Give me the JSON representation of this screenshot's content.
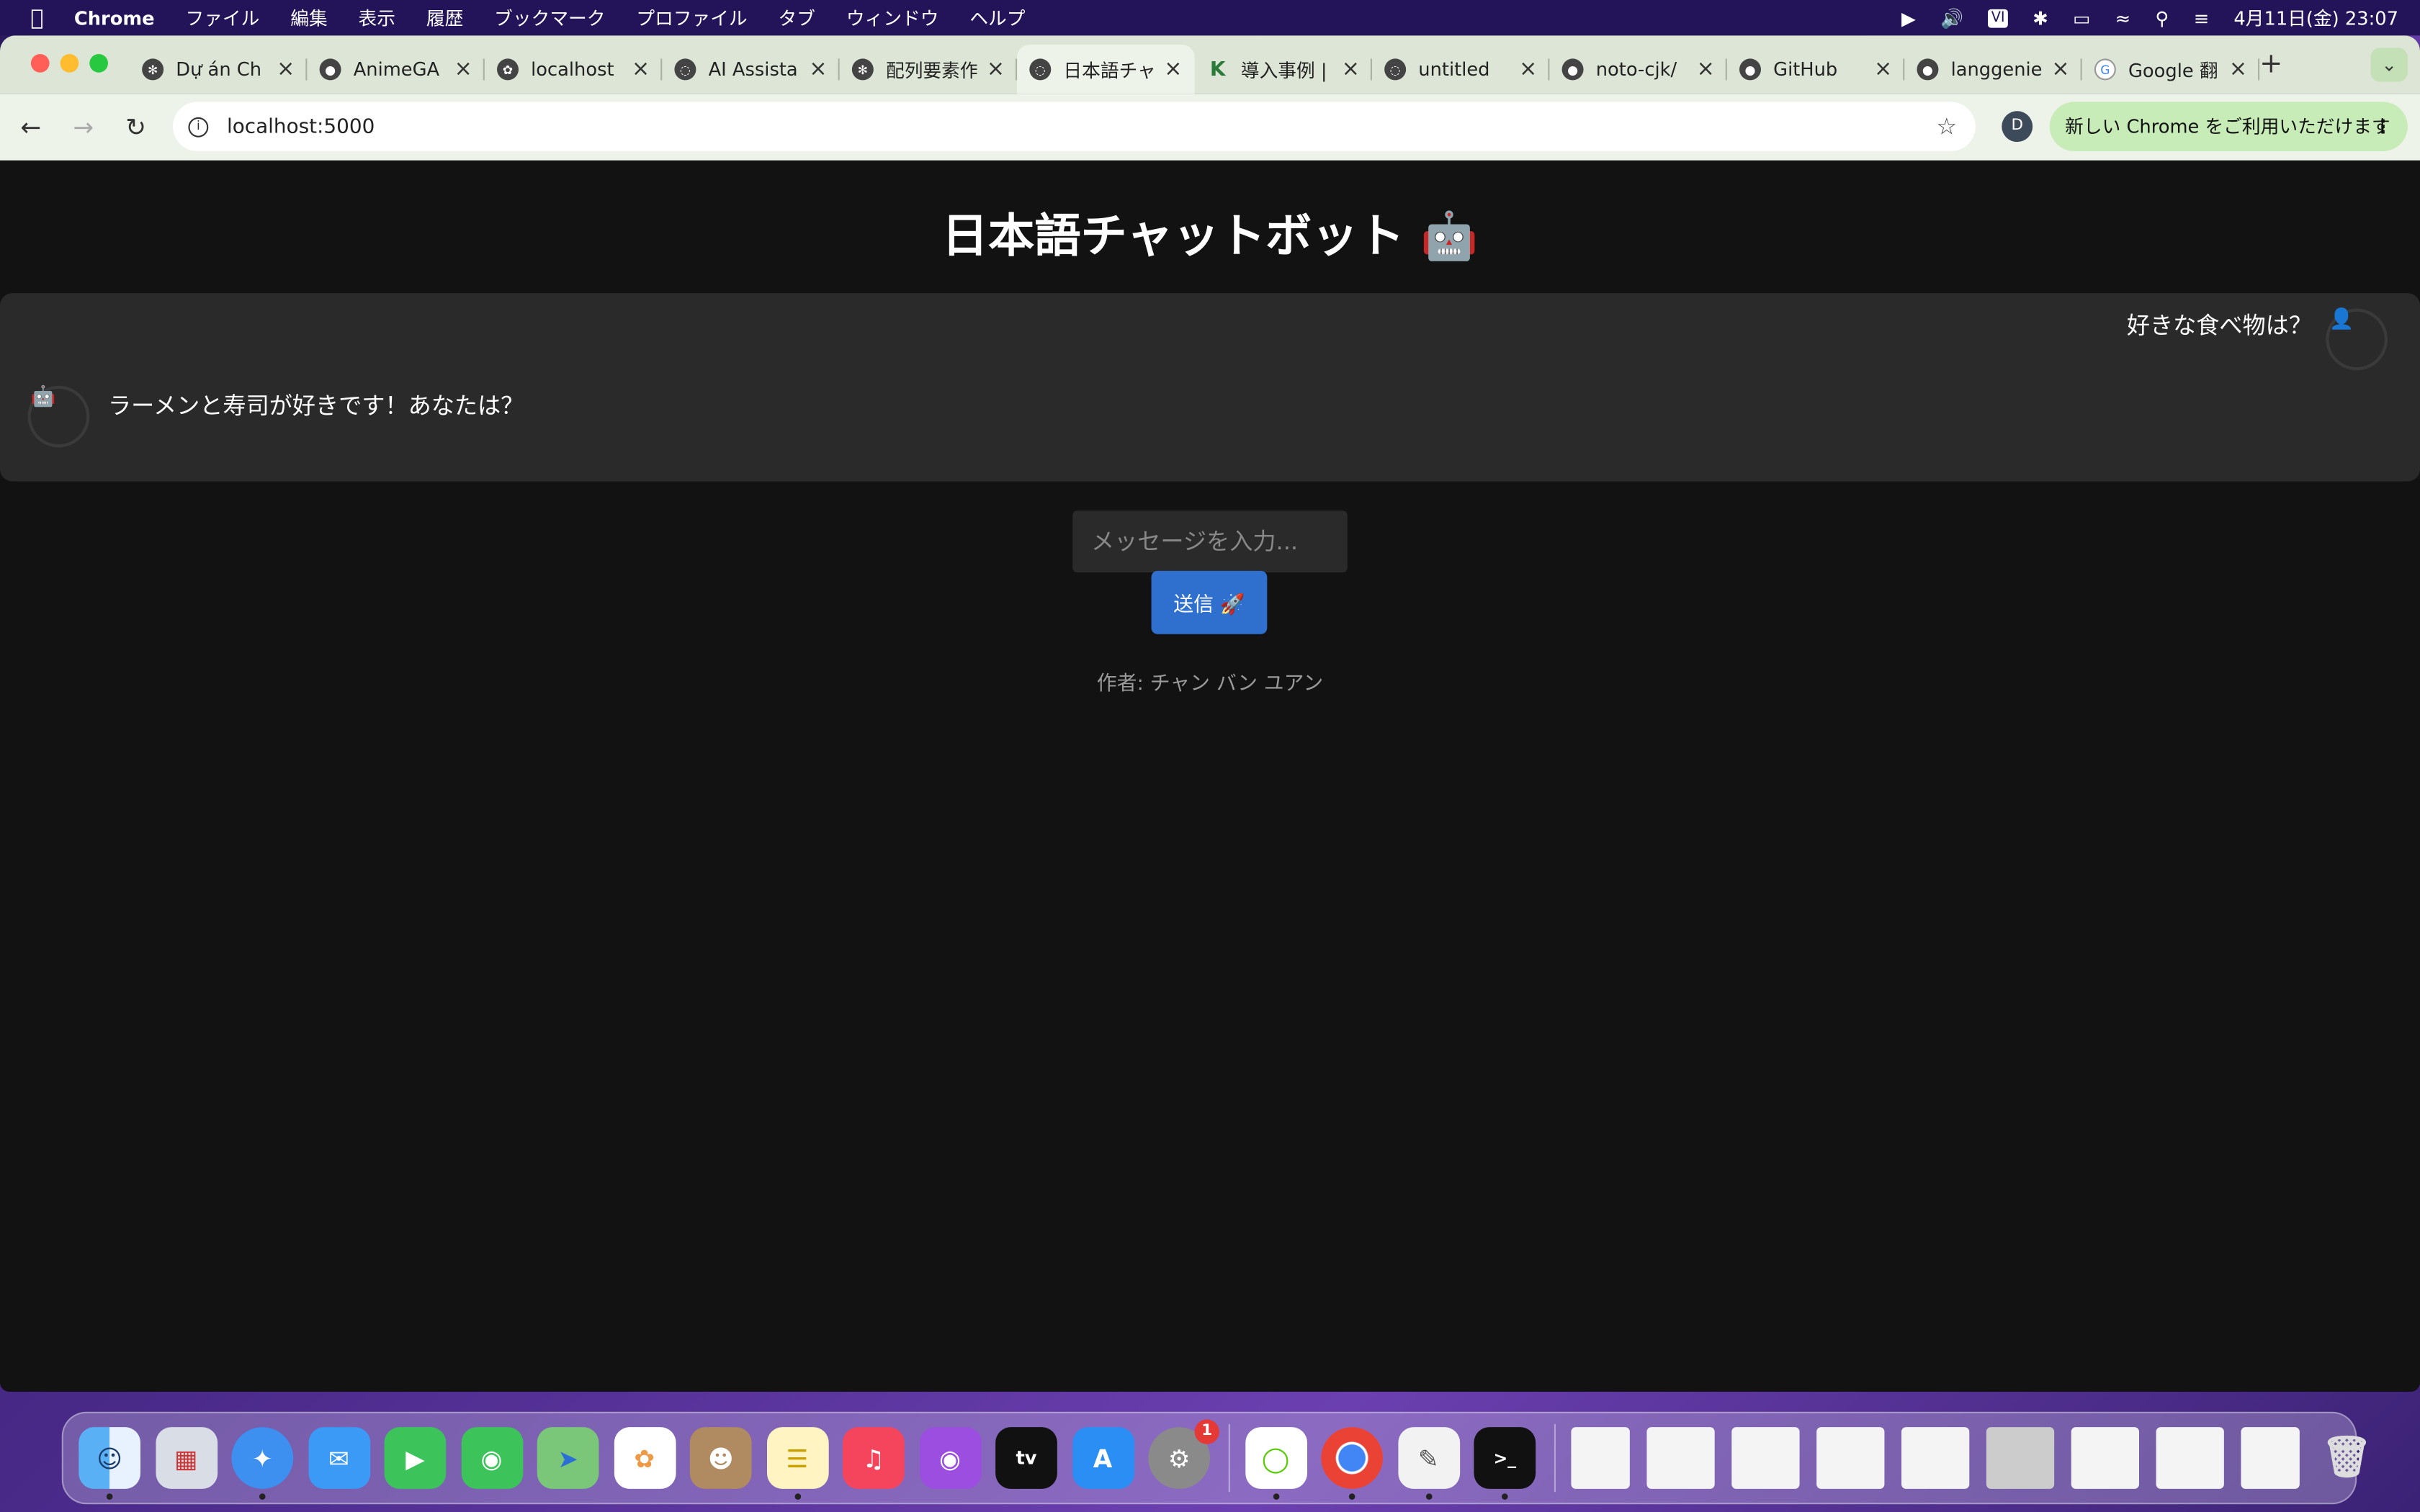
{
  "menubar": {
    "app": "Chrome",
    "items": [
      "ファイル",
      "編集",
      "表示",
      "履歴",
      "ブックマーク",
      "プロファイル",
      "タブ",
      "ウィンドウ",
      "ヘルプ"
    ],
    "datetime": "4月11日(金)  23:07"
  },
  "browser": {
    "tabs": [
      {
        "title": "Dự án Ch",
        "icon": "openai-icon"
      },
      {
        "title": "AnimeGA",
        "icon": "github-icon"
      },
      {
        "title": "localhost",
        "icon": "flask-icon"
      },
      {
        "title": "AI Assista",
        "icon": "globe-icon"
      },
      {
        "title": "配列要素作",
        "icon": "openai-icon"
      },
      {
        "title": "日本語チャ",
        "icon": "globe-icon",
        "active": true
      },
      {
        "title": "導入事例 |",
        "icon": "k-icon"
      },
      {
        "title": "untitled",
        "icon": "globe-icon"
      },
      {
        "title": "noto-cjk/",
        "icon": "github-icon"
      },
      {
        "title": "GitHub",
        "icon": "github-icon"
      },
      {
        "title": "langgenie",
        "icon": "github-icon"
      },
      {
        "title": "Google 翻",
        "icon": "google-translate-icon"
      }
    ],
    "url": "localhost:5000",
    "profile_initial": "D",
    "promo": "新しい Chrome をご利用いただけます"
  },
  "page": {
    "title": "日本語チャットボット 🤖",
    "messages": {
      "user": "好きな食べ物は？",
      "user_avatar": "👤",
      "bot": "ラーメンと寿司が好きです！あなたは？",
      "bot_avatar": "🤖"
    },
    "input_placeholder": "メッセージを入力...",
    "send_label": "送信 🚀",
    "author": "作者: チャン バン ユアン"
  },
  "dock": {
    "settings_badge": "1",
    "apps": [
      "finder",
      "launchpad",
      "safari",
      "mail",
      "facetime",
      "messages",
      "maps",
      "photos",
      "contacts",
      "notes",
      "music",
      "podcasts",
      "tv",
      "app-store",
      "system-settings",
      "duolingo",
      "chrome",
      "textedit",
      "terminal"
    ]
  },
  "colors": {
    "page_bg": "#121212",
    "chat_bg": "#2a2a2a",
    "send_button": "#2f6fce"
  }
}
